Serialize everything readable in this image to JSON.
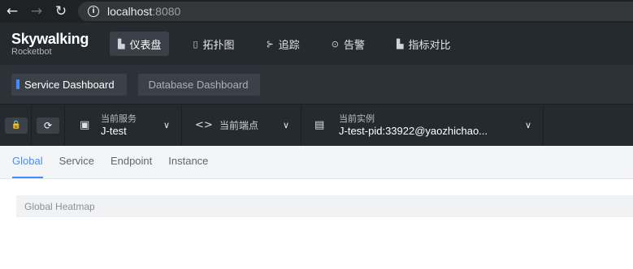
{
  "browser": {
    "back_icon": "←",
    "forward_icon": "→",
    "reload_icon": "↻",
    "info_icon": "i",
    "url_host": "localhost",
    "url_port": ":8080"
  },
  "logo": {
    "title": "Skywalking",
    "subtitle": "Rocketbot"
  },
  "nav": [
    {
      "icon": "▙",
      "label": "仪表盘"
    },
    {
      "icon": "▯",
      "label": "拓扑图"
    },
    {
      "icon": "⊱",
      "label": "追踪"
    },
    {
      "icon": "⊙",
      "label": "告警"
    },
    {
      "icon": "▙",
      "label": "指标对比"
    }
  ],
  "dashboards": [
    {
      "label": "Service Dashboard"
    },
    {
      "label": "Database Dashboard"
    }
  ],
  "toolbar": {
    "lock_icon": "🔒",
    "reload_icon": "⟳",
    "service": {
      "icon": "▣",
      "label": "当前服务",
      "value": "J-test"
    },
    "endpoint": {
      "icon": "<>",
      "label": "当前端点"
    },
    "instance": {
      "icon": "▤",
      "label": "当前实例",
      "value": "J-test-pid:33922@yaozhichao..."
    },
    "chevron": "∨"
  },
  "tabs": [
    "Global",
    "Service",
    "Endpoint",
    "Instance"
  ],
  "widget": {
    "title": "Global Heatmap"
  },
  "colors": {
    "accent": "#448dfe",
    "header_bg": "#252a2f",
    "browser_bg": "#202124"
  }
}
